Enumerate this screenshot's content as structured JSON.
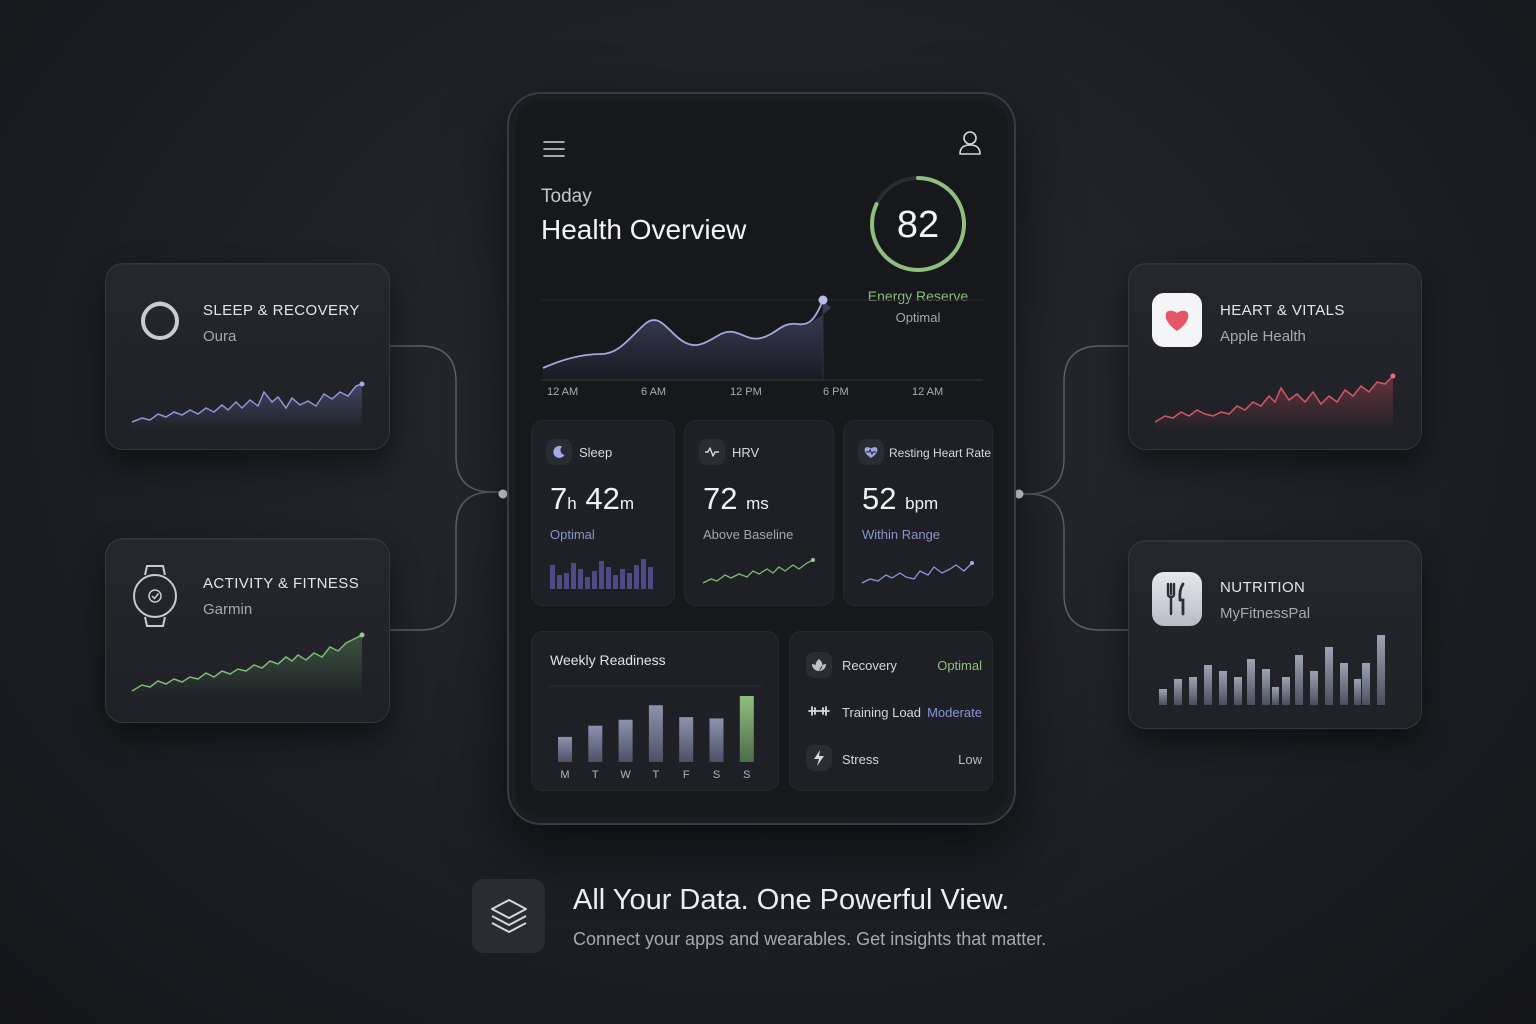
{
  "header": {
    "eyebrow": "Today",
    "title": "Health Overview",
    "score": "82",
    "score_label": "Energy Reserve",
    "score_status": "Optimal",
    "score_fraction": 0.82
  },
  "main_chart": {
    "x_ticks": [
      "12 AM",
      "6 AM",
      "12 PM",
      "6 PM",
      "12 AM"
    ]
  },
  "metrics": [
    {
      "label": "Sleep",
      "value_h": "7",
      "unit_h": "h",
      "value_m": "42",
      "unit_m": "m",
      "status": "Optimal"
    },
    {
      "label": "HRV",
      "value": "72",
      "unit": "ms",
      "status": "Above Baseline"
    },
    {
      "label": "Resting Heart Rate",
      "value": "52",
      "unit": "bpm",
      "status": "Within Range"
    }
  ],
  "weekly": {
    "title": "Weekly Readiness",
    "days": [
      "M",
      "T",
      "W",
      "T",
      "F",
      "S",
      "S"
    ],
    "values": [
      0.38,
      0.55,
      0.64,
      0.86,
      0.68,
      0.66,
      1.0
    ]
  },
  "status_rows": [
    {
      "label": "Recovery",
      "value": "Optimal",
      "color": "#8fbf7f"
    },
    {
      "label": "Training Load",
      "value": "Moderate",
      "color": "#8c93d9"
    },
    {
      "label": "Stress",
      "value": "Low",
      "color": "#b9bbc2"
    }
  ],
  "sources": {
    "sleep": {
      "title": "SLEEP & RECOVERY",
      "app": "Oura"
    },
    "activity": {
      "title": "ACTIVITY & FITNESS",
      "app": "Garmin"
    },
    "heart": {
      "title": "HEART & VITALS",
      "app": "Apple Health"
    },
    "nutrition": {
      "title": "NUTRITION",
      "app": "MyFitnessPal"
    }
  },
  "footer": {
    "headline": "All Your Data. One Powerful View.",
    "subline": "Connect your apps and wearables. Get insights that matter."
  },
  "colors": {
    "accent_green": "#8fbf7f",
    "accent_purple": "#8c93d9",
    "accent_red": "#e05a6a"
  }
}
